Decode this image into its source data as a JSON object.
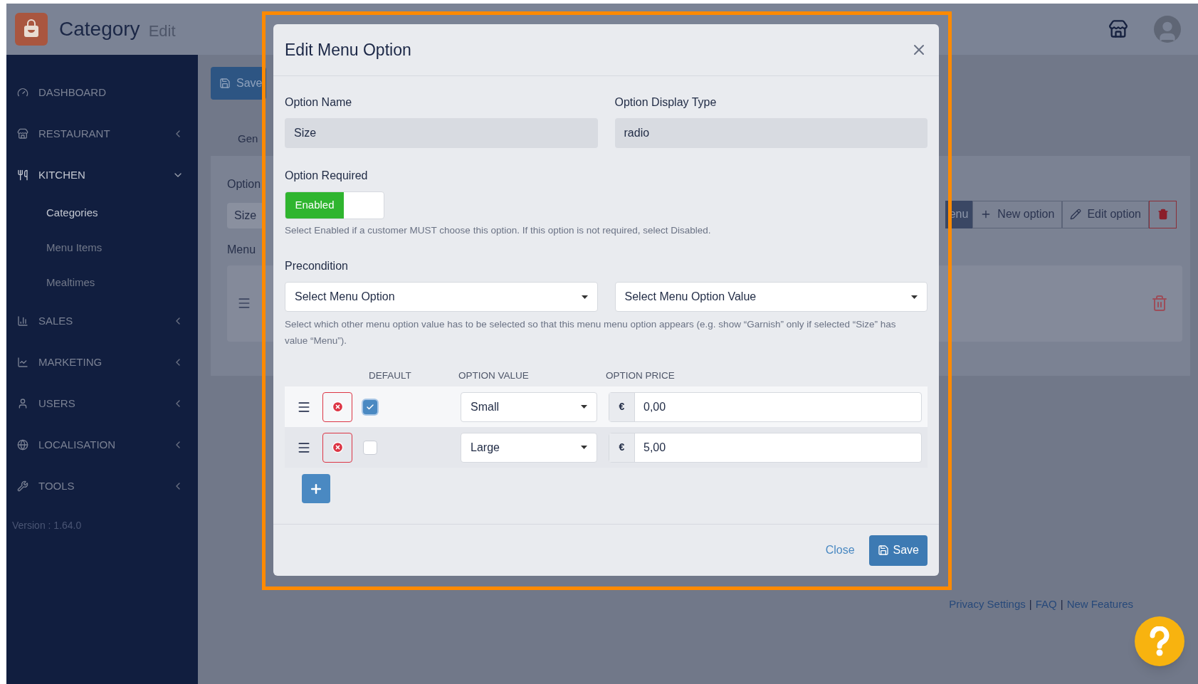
{
  "app": {
    "title": "Category",
    "subtitle": "Edit"
  },
  "sidebar": {
    "items": [
      {
        "label": "DASHBOARD"
      },
      {
        "label": "RESTAURANT",
        "expanded": false
      },
      {
        "label": "KITCHEN",
        "expanded": true,
        "children": [
          {
            "label": "Categories",
            "selected": true
          },
          {
            "label": "Menu Items",
            "selected": false
          },
          {
            "label": "Mealtimes",
            "selected": false
          }
        ]
      },
      {
        "label": "SALES",
        "expanded": false
      },
      {
        "label": "MARKETING",
        "expanded": false
      },
      {
        "label": "USERS",
        "expanded": false
      },
      {
        "label": "LOCALISATION",
        "expanded": false
      },
      {
        "label": "TOOLS",
        "expanded": false
      }
    ],
    "version": "Version : 1.64.0"
  },
  "background": {
    "save_button": "Save",
    "tab": "Gen",
    "option_label": "Option",
    "option_field": "Size",
    "menu_options_label": "Menu",
    "toolbar": [
      "enu",
      "New option",
      "Edit option"
    ]
  },
  "footer_links": [
    "Privacy Settings",
    "FAQ",
    "New Features"
  ],
  "footer_separators": [
    "|",
    "|"
  ],
  "modal": {
    "title": "Edit Menu Option",
    "option_name": {
      "label": "Option Name",
      "value": "Size"
    },
    "display_type": {
      "label": "Option Display Type",
      "value": "radio"
    },
    "required": {
      "label": "Option Required",
      "on": true,
      "text": "Enabled",
      "help": "Select Enabled if a customer MUST choose this option. If this option is not required, select Disabled."
    },
    "precondition": {
      "label": "Precondition",
      "option_select": "Select Menu Option",
      "value_select": "Select Menu Option Value",
      "help": "Select which other menu option value has to be selected so that this menu menu option appears (e.g. show “Garnish” only if selected “Size” has value “Menu”)."
    },
    "columns": [
      "DEFAULT",
      "OPTION VALUE",
      "OPTION PRICE"
    ],
    "rows": [
      {
        "selected": true,
        "default": true,
        "value": "Small",
        "currency": "€",
        "price": "0,00"
      },
      {
        "selected": false,
        "default": false,
        "value": "Large",
        "currency": "€",
        "price": "5,00"
      }
    ],
    "close_button": "Close",
    "save_button": "Save"
  }
}
